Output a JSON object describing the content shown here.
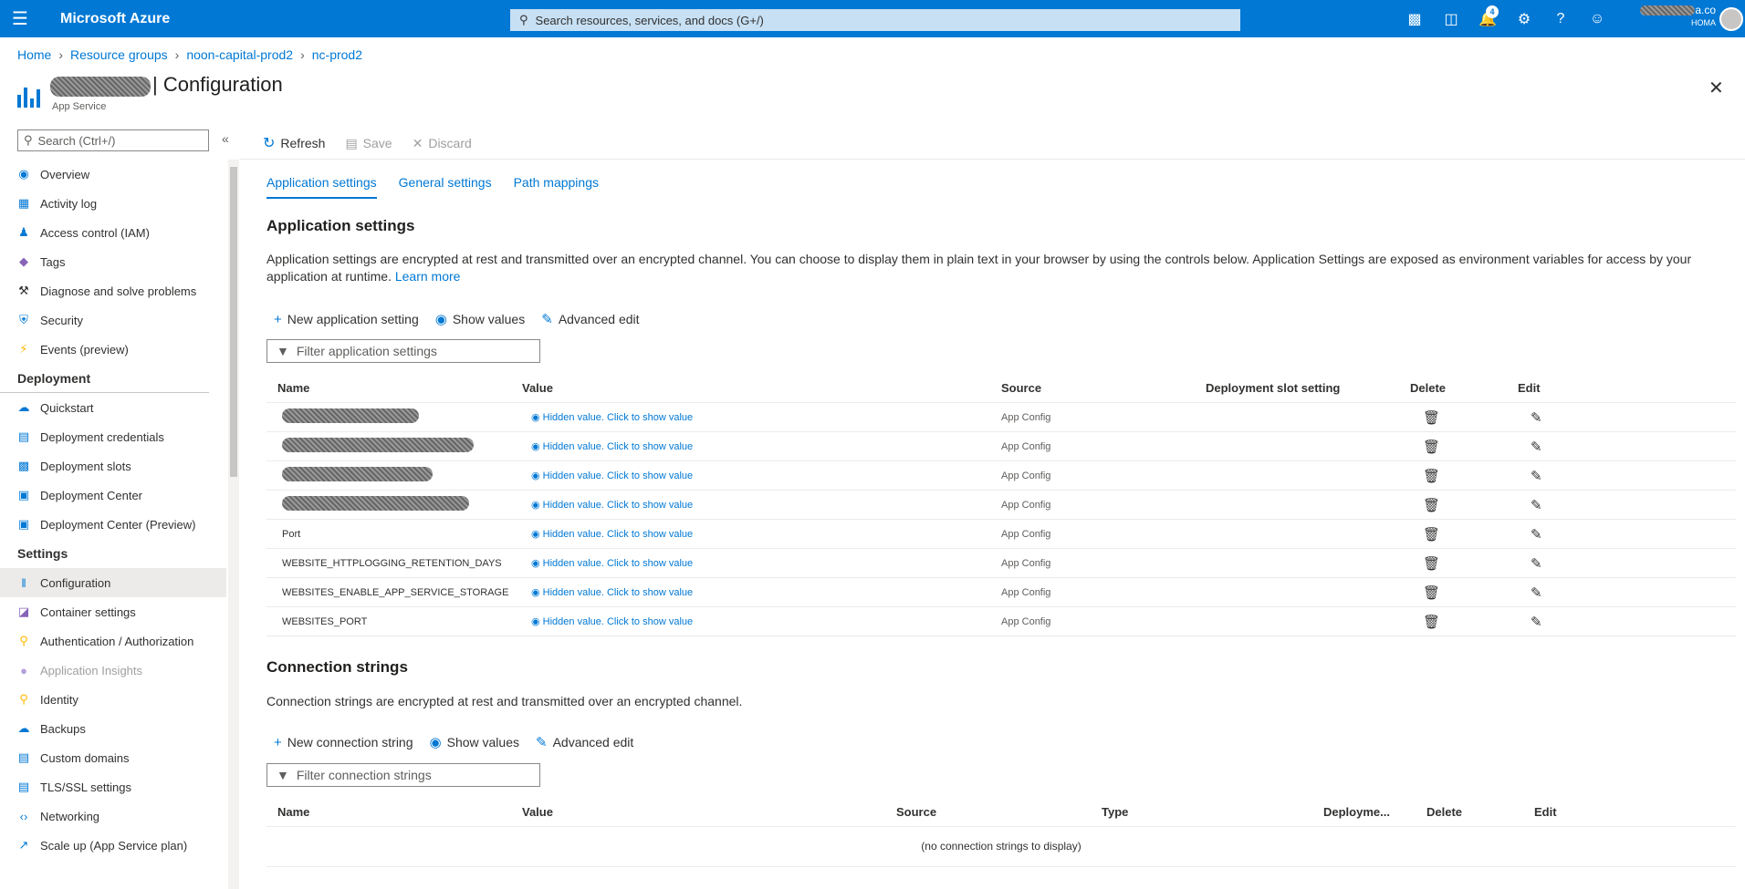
{
  "topbar": {
    "brand": "Microsoft Azure",
    "search_placeholder": "Search resources, services, and docs (G+/)",
    "notification_count": "4",
    "account_suffix": "a.co",
    "account_directory": "HOMA"
  },
  "breadcrumb": [
    "Home",
    "Resource groups",
    "noon-capital-prod2",
    "nc-prod2"
  ],
  "header": {
    "title": "| Configuration",
    "subtitle": "App Service"
  },
  "sidebar": {
    "search_placeholder": "Search (Ctrl+/)",
    "items": [
      {
        "label": "Overview",
        "icon": "globe-icon"
      },
      {
        "label": "Activity log",
        "icon": "log-icon"
      },
      {
        "label": "Access control (IAM)",
        "icon": "people-icon"
      },
      {
        "label": "Tags",
        "icon": "tag-icon"
      },
      {
        "label": "Diagnose and solve problems",
        "icon": "wrench-icon"
      },
      {
        "label": "Security",
        "icon": "shield-icon"
      },
      {
        "label": "Events (preview)",
        "icon": "lightning-icon"
      }
    ],
    "section_deployment": "Deployment",
    "deployment_items": [
      {
        "label": "Quickstart",
        "icon": "cloud-icon"
      },
      {
        "label": "Deployment credentials",
        "icon": "credentials-icon"
      },
      {
        "label": "Deployment slots",
        "icon": "slots-icon"
      },
      {
        "label": "Deployment Center",
        "icon": "cube-icon"
      },
      {
        "label": "Deployment Center (Preview)",
        "icon": "cube-icon"
      }
    ],
    "section_settings": "Settings",
    "settings_items": [
      {
        "label": "Configuration",
        "icon": "config-icon"
      },
      {
        "label": "Container settings",
        "icon": "container-icon"
      },
      {
        "label": "Authentication / Authorization",
        "icon": "key-icon"
      },
      {
        "label": "Application Insights",
        "icon": "insights-icon"
      },
      {
        "label": "Identity",
        "icon": "identity-icon"
      },
      {
        "label": "Backups",
        "icon": "backup-icon"
      },
      {
        "label": "Custom domains",
        "icon": "domain-icon"
      },
      {
        "label": "TLS/SSL settings",
        "icon": "tls-icon"
      },
      {
        "label": "Networking",
        "icon": "network-icon"
      },
      {
        "label": "Scale up (App Service plan)",
        "icon": "scale-up-icon"
      }
    ]
  },
  "commands": {
    "refresh": "Refresh",
    "save": "Save",
    "discard": "Discard"
  },
  "tabs": [
    "Application settings",
    "General settings",
    "Path mappings"
  ],
  "app_settings": {
    "heading": "Application settings",
    "description": "Application settings are encrypted at rest and transmitted over an encrypted channel. You can choose to display them in plain text in your browser by using the controls below. Application Settings are exposed as environment variables for access by your application at runtime.",
    "learn_more": "Learn more",
    "new_label": "New application setting",
    "show_values": "Show values",
    "advanced_edit": "Advanced edit",
    "filter_placeholder": "Filter application settings",
    "columns": [
      "Name",
      "Value",
      "Source",
      "Deployment slot setting",
      "Delete",
      "Edit"
    ],
    "rows": [
      {
        "name": "",
        "value": "Hidden value. Click to show value",
        "source": "App Config"
      },
      {
        "name": "",
        "value": "Hidden value. Click to show value",
        "source": "App Config"
      },
      {
        "name": "",
        "value": "Hidden value. Click to show value",
        "source": "App Config"
      },
      {
        "name": "",
        "value": "Hidden value. Click to show value",
        "source": "App Config"
      },
      {
        "name": "Port",
        "value": "Hidden value. Click to show value",
        "source": "App Config"
      },
      {
        "name": "WEBSITE_HTTPLOGGING_RETENTION_DAYS",
        "value": "Hidden value. Click to show value",
        "source": "App Config"
      },
      {
        "name": "WEBSITES_ENABLE_APP_SERVICE_STORAGE",
        "value": "Hidden value. Click to show value",
        "source": "App Config"
      },
      {
        "name": "WEBSITES_PORT",
        "value": "Hidden value. Click to show value",
        "source": "App Config"
      }
    ]
  },
  "conn_strings": {
    "heading": "Connection strings",
    "description": "Connection strings are encrypted at rest and transmitted over an encrypted channel.",
    "new_label": "New connection string",
    "show_values": "Show values",
    "advanced_edit": "Advanced edit",
    "filter_placeholder": "Filter connection strings",
    "columns": [
      "Name",
      "Value",
      "Source",
      "Type",
      "Deployme...",
      "Delete",
      "Edit"
    ],
    "empty": "(no connection strings to display)"
  }
}
